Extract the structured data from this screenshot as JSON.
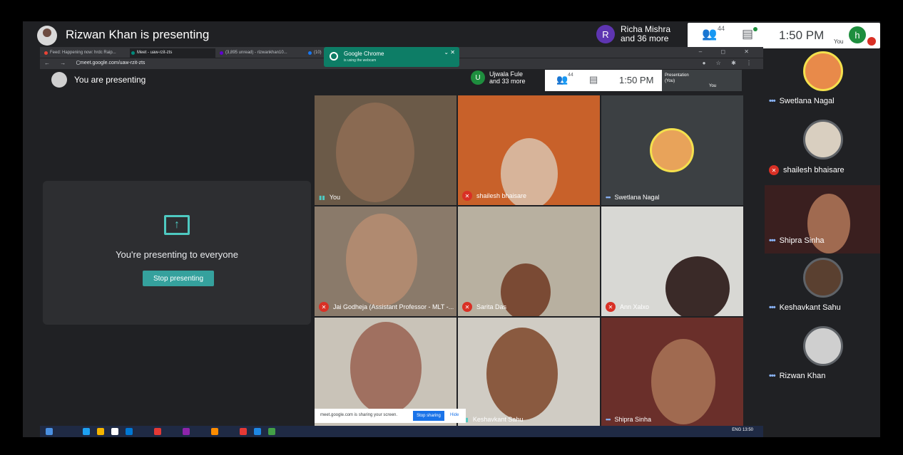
{
  "meeting": {
    "presenter_title": "Rizwan Khan is presenting",
    "chip_letter": "R",
    "chip_line1": "Richa Mishra",
    "chip_line2": "and 36 more",
    "people_count": "44",
    "time": "1:50 PM",
    "self_letter": "h",
    "self_label": "You"
  },
  "browser": {
    "tabs": [
      {
        "label": "Feed: Happening now: hrdc Raip...",
        "color": "#ea4335"
      },
      {
        "label": "Meet - uaw-rzit-zts",
        "color": "#00897b"
      },
      {
        "label": "(3,895 unread) - rizwankhan10...",
        "color": "#6001d2"
      },
      {
        "label": "(10)",
        "color": "#1877f2"
      }
    ],
    "url": "meet.google.com/uaw-rzit-zts",
    "notification_title": "Google Chrome",
    "notification_sub": "is using the webcam",
    "inner_title": "You are presenting",
    "inner_chip_letter": "U",
    "inner_chip_line1": "Ujwala Fule",
    "inner_chip_line2": "and 33 more",
    "inner_people_count": "44",
    "inner_time": "1:50 PM",
    "inner_presentation": "Presentation",
    "inner_you_paren": "(You)",
    "inner_you": "You",
    "share_text": "meet.google.com is sharing your screen.",
    "share_stop": "Stop sharing",
    "share_hide": "Hide",
    "tray_text": "ENG",
    "tray_time": "13:50"
  },
  "present_card": {
    "message": "You're presenting to everyone",
    "button": "Stop presenting"
  },
  "tiles": [
    {
      "name": "You",
      "status": "speaking",
      "bg": "#6b5a48"
    },
    {
      "name": "shailesh bhaisare",
      "status": "muted",
      "bg": "#c8612a"
    },
    {
      "name": "Swetlana Nagal",
      "status": "dots",
      "bg": "#3c4043"
    },
    {
      "name": "Jai Godheja (Assistant Professor - MLT -...",
      "status": "muted",
      "bg": "#8a7a6a"
    },
    {
      "name": "Sarita Das",
      "status": "muted",
      "bg": "#b8b0a0"
    },
    {
      "name": "Ann Xalxo",
      "status": "muted",
      "bg": "#d8d8d4"
    },
    {
      "name": "",
      "status": "none",
      "bg": "#c9c3b8"
    },
    {
      "name": "Keshavkant Sahu",
      "status": "speaking",
      "bg": "#d0ccc4"
    },
    {
      "name": "Shipra Sinha",
      "status": "dots",
      "bg": "#6a2f2a"
    }
  ],
  "sidebar": [
    {
      "name": "Swetlana Nagal",
      "status": "dots"
    },
    {
      "name": "shailesh bhaisare",
      "status": "muted"
    },
    {
      "name": "Shipra Sinha",
      "status": "dots"
    },
    {
      "name": "Keshavkant Sahu",
      "status": "dots"
    },
    {
      "name": "Rizwan Khan",
      "status": "dots"
    }
  ],
  "colors": {
    "accent": "#1e8e3e",
    "muted": "#d93025",
    "teal": "#35a19d"
  }
}
